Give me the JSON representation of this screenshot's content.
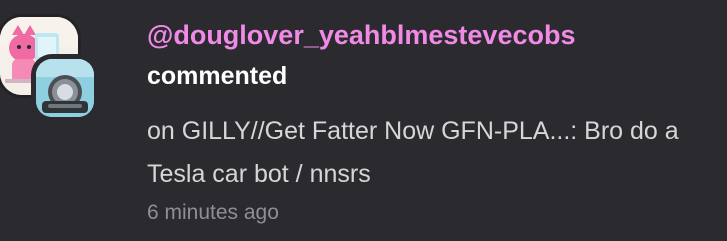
{
  "notification": {
    "username": "@douglover_yeahblmestevecobs",
    "action": "commented",
    "message": "on GILLY//Get Fatter Now GFN-PLA...: Bro do a Tesla car bot / nnsrs",
    "timestamp": "6 minutes ago",
    "avatar_icon": "user-avatar-icon",
    "sub_avatar_icon": "bot-avatar-icon",
    "colors": {
      "background": "#2b2b2f",
      "username": "#f08ae6",
      "action": "#ffffff",
      "message": "#d6d6d8",
      "timestamp": "#8e8e93"
    }
  }
}
